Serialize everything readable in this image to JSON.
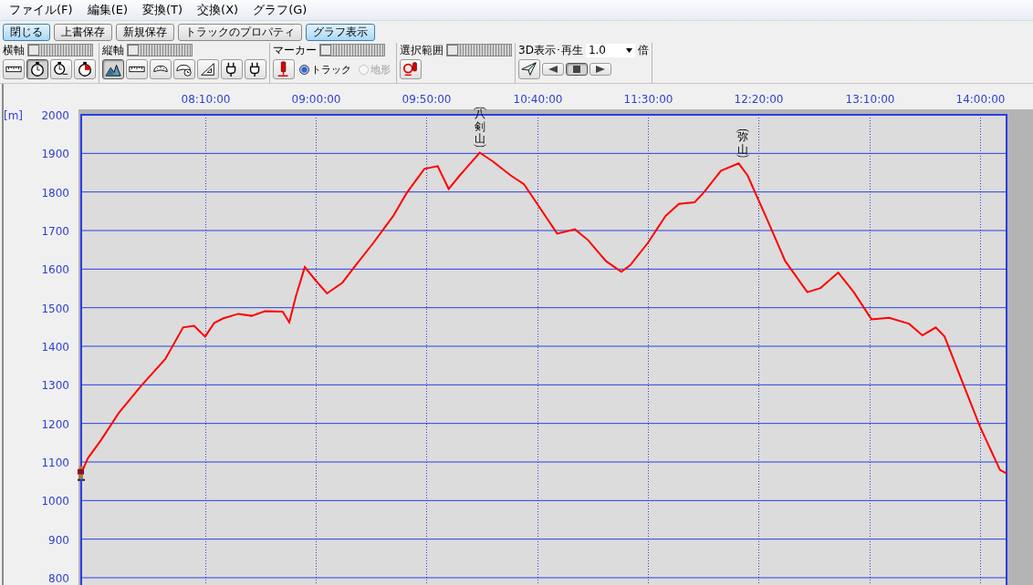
{
  "menu": [
    "ファイル(F)",
    "編集(E)",
    "変換(T)",
    "交換(X)",
    "グラフ(G)"
  ],
  "buttons": [
    {
      "label": "閉じる",
      "selected": true
    },
    {
      "label": "上書保存",
      "selected": false
    },
    {
      "label": "新規保存",
      "selected": false
    },
    {
      "label": "トラックのプロパティ",
      "selected": false
    },
    {
      "label": "グラフ表示",
      "selected": true
    }
  ],
  "tool_groups": [
    {
      "kind": "axis",
      "label": "横軸",
      "slider": {
        "level": 0
      },
      "tools": [
        {
          "selected": false
        },
        {
          "selected": true
        },
        {
          "selected": false
        },
        {
          "selected": false
        }
      ]
    },
    {
      "kind": "vaxis",
      "label": "縦軸",
      "slider": {
        "level": 0
      },
      "tools": [
        {
          "selected": true
        },
        {
          "selected": false
        },
        {
          "selected": false
        },
        {
          "selected": false
        },
        {
          "selected": false
        },
        {
          "selected": false
        },
        {
          "selected": false
        }
      ]
    },
    {
      "kind": "marker",
      "label": "マーカー",
      "slider": {
        "level": 0
      },
      "tools": [
        {
          "selected": false
        }
      ],
      "radios": [
        {
          "label": "トラック",
          "checked": true,
          "disabled": false
        },
        {
          "label": "地形",
          "checked": false,
          "disabled": true
        }
      ]
    },
    {
      "kind": "range",
      "label": "選択範囲",
      "slider": {
        "level": 0
      },
      "tools": [
        {
          "selected": false
        }
      ]
    },
    {
      "kind": "playback",
      "label": "3D表示･再生",
      "speed": "1.0",
      "unit": "倍",
      "tools": [
        {
          "selected": false
        },
        {
          "selected": false
        },
        {
          "selected": true
        },
        {
          "selected": false
        }
      ]
    }
  ],
  "graph": {
    "chart_data": {
      "type": "line",
      "ylabel": "[m]",
      "grid": true,
      "x": [
        434,
        437,
        443,
        451,
        461,
        472,
        480,
        485,
        490,
        494,
        498,
        505,
        511,
        517,
        525,
        528,
        531,
        535,
        540,
        545,
        552,
        558,
        566,
        575,
        581,
        589,
        595,
        600,
        605,
        614,
        620,
        628,
        634,
        640,
        649,
        657,
        663,
        671,
        678,
        682,
        690,
        698,
        704,
        711,
        715,
        723,
        731,
        735,
        744,
        752,
        762,
        768,
        776,
        783,
        791,
        799,
        808,
        814,
        820,
        824,
        832,
        840,
        849,
        852
      ],
      "series": [
        {
          "color": "#ff0000",
          "values": [
            1070,
            1110,
            1157,
            1227,
            1297,
            1367,
            1449,
            1453,
            1425,
            1460,
            1472,
            1484,
            1479,
            1491,
            1490,
            1462,
            1530,
            1605,
            1570,
            1537,
            1565,
            1610,
            1668,
            1738,
            1797,
            1860,
            1867,
            1808,
            1843,
            1902,
            1879,
            1843,
            1820,
            1769,
            1692,
            1703,
            1675,
            1621,
            1593,
            1610,
            1668,
            1738,
            1769,
            1773,
            1797,
            1855,
            1874,
            1843,
            1727,
            1621,
            1540,
            1551,
            1591,
            1540,
            1470,
            1474,
            1458,
            1428,
            1449,
            1425,
            1308,
            1192,
            1080,
            1070
          ]
        }
      ],
      "xlim": [
        434,
        852
      ],
      "ylim": [
        800,
        2000
      ],
      "xticks": [
        {
          "value": 490,
          "label": "08:10:00"
        },
        {
          "value": 540,
          "label": "09:00:00"
        },
        {
          "value": 590,
          "label": "09:50:00"
        },
        {
          "value": 640,
          "label": "10:40:00"
        },
        {
          "value": 690,
          "label": "11:30:00"
        },
        {
          "value": 740,
          "label": "12:20:00"
        },
        {
          "value": 790,
          "label": "13:10:00"
        },
        {
          "value": 840,
          "label": "14:00:00"
        }
      ],
      "yticks": [
        800,
        900,
        1000,
        1100,
        1200,
        1300,
        1400,
        1500,
        1600,
        1700,
        1800,
        1900,
        2000
      ],
      "annotations": [
        {
          "x": 614,
          "y": 1902,
          "text": "八剣山"
        },
        {
          "x": 733,
          "y": 1876,
          "text": "弥山"
        }
      ]
    }
  }
}
